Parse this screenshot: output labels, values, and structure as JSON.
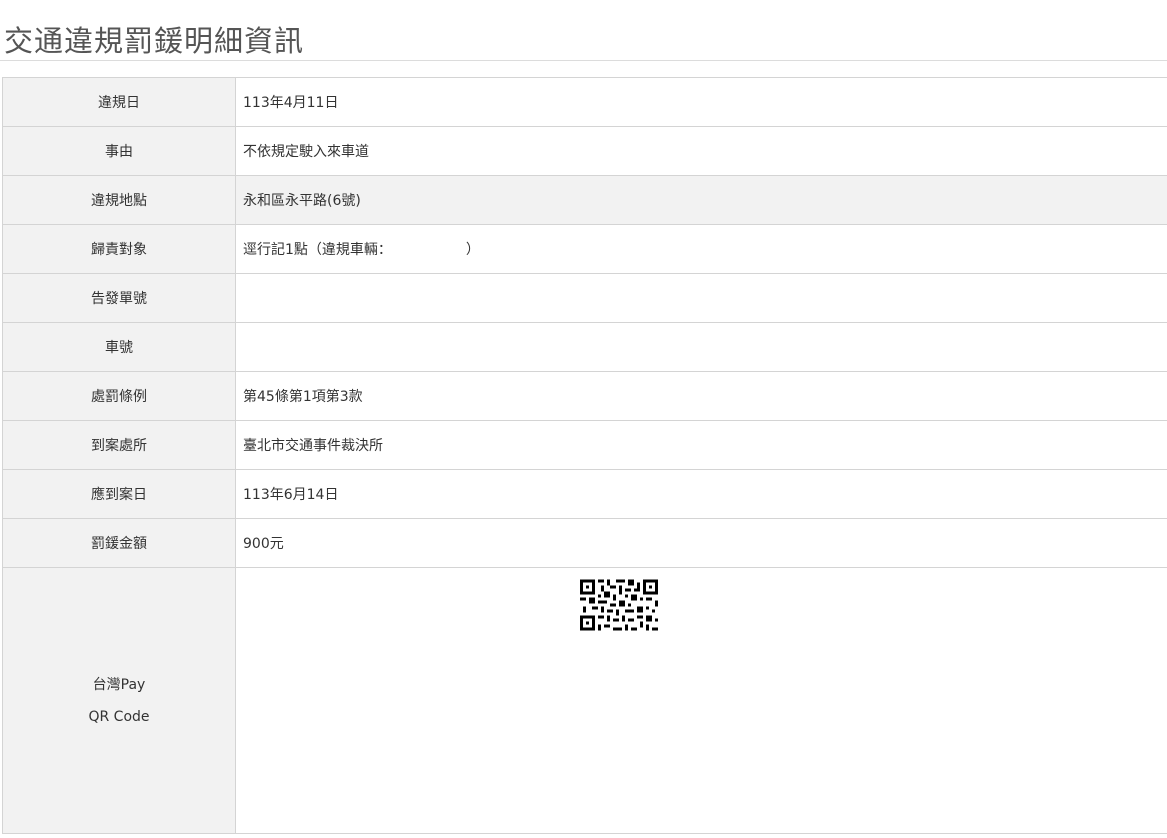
{
  "page": {
    "title": "交通違規罰鍰明細資訊"
  },
  "rows": [
    {
      "label": "違規日",
      "value": "113年4月11日"
    },
    {
      "label": "事由",
      "value": "不依規定駛入來車道"
    },
    {
      "label": "違規地點",
      "value": "永和區永平路(6號)"
    },
    {
      "label": "歸責對象",
      "value_prefix": "逕行記1點（違規車輛：",
      "value_suffix": "）"
    },
    {
      "label": "告發單號",
      "value": ""
    },
    {
      "label": "車號",
      "value": ""
    },
    {
      "label": "處罰條例",
      "value": "第45條第1項第3款"
    },
    {
      "label": "到案處所",
      "value": "臺北市交通事件裁決所"
    },
    {
      "label": "應到案日",
      "value": "113年6月14日"
    },
    {
      "label": "罰鍰金額",
      "value": "900元"
    }
  ],
  "qr_row": {
    "label_line1": "台灣Pay",
    "label_line2": "QR Code",
    "qr_icon": "qr-code-icon"
  }
}
